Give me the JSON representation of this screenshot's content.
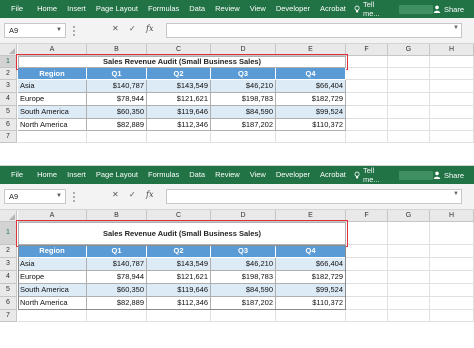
{
  "ribbon": {
    "tabs": [
      "File",
      "Home",
      "Insert",
      "Page Layout",
      "Formulas",
      "Data",
      "Review",
      "View",
      "Developer",
      "Acrobat"
    ],
    "tell_me": "Tell me...",
    "share": "Share"
  },
  "formula_bar": {
    "name_box": "A9",
    "formula": "",
    "fx_label": "fx"
  },
  "columns": [
    "A",
    "B",
    "C",
    "D",
    "E",
    "F",
    "G",
    "H"
  ],
  "rows": [
    "1",
    "2",
    "3",
    "4",
    "5",
    "6",
    "7"
  ],
  "sheet": {
    "title": "Sales Revenue Audit (Small Business Sales)",
    "headers": [
      "Region",
      "Q1",
      "Q2",
      "Q3",
      "Q4"
    ],
    "data": [
      [
        "Asia",
        "$140,787",
        "$143,549",
        "$46,210",
        "$66,404"
      ],
      [
        "Europe",
        "$78,944",
        "$121,621",
        "$198,783",
        "$182,729"
      ],
      [
        "South America",
        "$60,350",
        "$119,646",
        "$84,590",
        "$99,524"
      ],
      [
        "North America",
        "$82,889",
        "$112,346",
        "$187,202",
        "$110,372"
      ]
    ]
  },
  "colors": {
    "ribbon": "#217346",
    "header_fill": "#5b9bd5",
    "band_fill": "#ddebf7",
    "highlight_box": "#e0303a"
  }
}
